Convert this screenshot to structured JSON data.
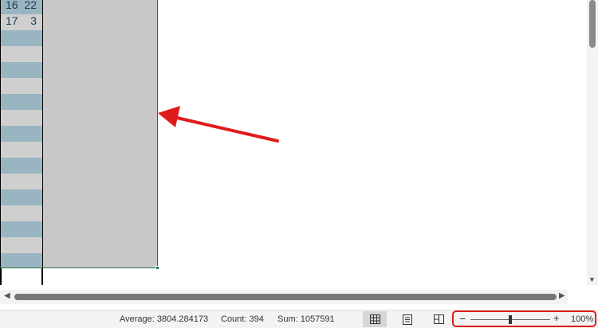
{
  "sheet": {
    "rows": [
      {
        "a": "16",
        "b": "22"
      },
      {
        "a": "17",
        "b": "3"
      }
    ]
  },
  "status": {
    "average_label": "Average: 3804.284173",
    "count_label": "Count: 394",
    "sum_label": "Sum: 1057591",
    "zoom_level": "100%"
  },
  "view_buttons": [
    "normal-view",
    "page-layout-view",
    "page-break-preview"
  ],
  "colors": {
    "stripe_blue": "#9ab5c2",
    "stripe_gray": "#cfcfcf",
    "selection_fill": "#c8c8c8",
    "selection_border": "#217346",
    "annotation_red": "#e11b1b"
  }
}
